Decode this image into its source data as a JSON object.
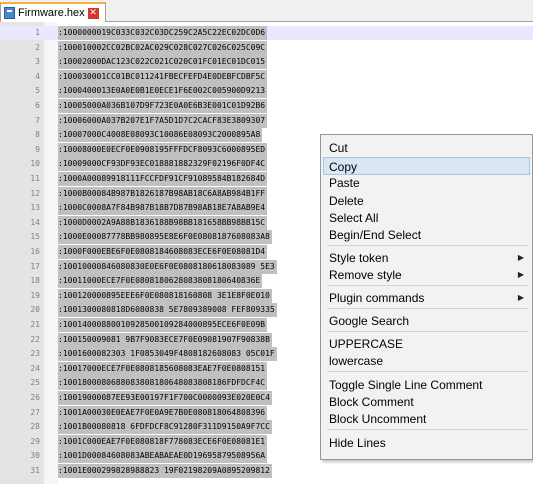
{
  "tab": {
    "title": "Firmware.hex",
    "file_icon": "file-icon",
    "close_icon": "close-icon"
  },
  "editor": {
    "lines": [
      {
        "n": "1",
        "text": ":1000000019C033C032C03DC259C2A5C22EC02DC0D6"
      },
      {
        "n": "2",
        "text": ":100010002CC02BC02AC029C028C027C026C025C09C"
      },
      {
        "n": "3",
        "text": ":10002000DAC123C022C021C020C01FC01EC01DC015"
      },
      {
        "n": "4",
        "text": ":100030001CC01BC011241FBECFEFD4E0DEBFCDBF5C"
      },
      {
        "n": "5",
        "text": ":1000400013E0A0E0B1E0ECE1F6E002C005900D9213"
      },
      {
        "n": "6",
        "text": ":10005000A036B107D9F723E0A0E6B3E001C01D92B6"
      },
      {
        "n": "7",
        "text": ":10006000A037B207E1F7A5D1D7C2CACF83E3809307"
      },
      {
        "n": "8",
        "text": ":10007000C4008E08093C10086E08093C2000895A8"
      },
      {
        "n": "9",
        "text": ":10008000E0ECF0E0908195FFFDCF8093C6000895ED"
      },
      {
        "n": "10",
        "text": ":10009000CF93DF93EC018881882329F02196F0DF4C"
      },
      {
        "n": "11",
        "text": ":1000A00089918111FCCFDF91CF91089584B182684D"
      },
      {
        "n": "12",
        "text": ":1000B00084B987B1826187B98AB18C6A8AB984B1FF"
      },
      {
        "n": "13",
        "text": ":1000C0008A7F84B987B18B7D87B98AB18E7A8AB9E4"
      },
      {
        "n": "14",
        "text": ":1000D0002A9A88B1836188B98BB181658BB98BB15C"
      },
      {
        "n": "15",
        "text": ":1000E00087778BB980895E8E6F0E0808187608083A8"
      },
      {
        "n": "16",
        "text": ":1000F000EBE6F0E0808184608083ECE6F0E08081D4"
      },
      {
        "n": "17",
        "text": ":10010000846080830E0E6F0E0808180618083089 5E3"
      },
      {
        "n": "18",
        "text": ":10011000ECE7F0E0808180628083808180640836E"
      },
      {
        "n": "19",
        "text": ":100120000895EEE6F0E080818160808 3E1E8F0E010"
      },
      {
        "n": "20",
        "text": ":1001300080818D6080838 5E7809389008 FEF809335"
      },
      {
        "n": "21",
        "text": ":10014000880010928500109284000895ECE6F0E09B"
      },
      {
        "n": "22",
        "text": ":100150009081 9B7F9083ECE7F0E09081907F90838B"
      },
      {
        "n": "23",
        "text": ":1001600082303 1F0853049F4808182608083 05C01F"
      },
      {
        "n": "24",
        "text": ":10017000ECE7F0E0808185608083EAE7F0E0808151"
      },
      {
        "n": "25",
        "text": ":1001800080688083808180648083808186FDFDCF4C"
      },
      {
        "n": "26",
        "text": ":10019000087EE93E00197F1F700C0000093E020E0C4"
      },
      {
        "n": "27",
        "text": ":1001A00030E0EAE7F0E0A9E7B0E080818064808396"
      },
      {
        "n": "28",
        "text": ":1001B00080818 6FDFDCF8C91280F311D9150A9F7CC"
      },
      {
        "n": "29",
        "text": ":1001C000EAE7F0E080818F778083ECE6F0E08081E1"
      },
      {
        "n": "30",
        "text": ":1001D00084608083ABEABAEAE0D19695879508956A"
      },
      {
        "n": "31",
        "text": ":1001E000299828988823 19F02198209A0895209812"
      }
    ]
  },
  "context_menu": {
    "items": [
      {
        "label": "Cut",
        "submenu": false
      },
      {
        "label": "Copy",
        "submenu": false,
        "highlighted": true
      },
      {
        "label": "Paste",
        "submenu": false
      },
      {
        "label": "Delete",
        "submenu": false
      },
      {
        "label": "Select All",
        "submenu": false
      },
      {
        "label": "Begin/End Select",
        "submenu": false
      },
      {
        "label": "Style token",
        "submenu": true
      },
      {
        "label": "Remove style",
        "submenu": true
      },
      {
        "label": "Plugin commands",
        "submenu": true
      },
      {
        "label": "Google Search",
        "submenu": false
      },
      {
        "label": "UPPERCASE",
        "submenu": false
      },
      {
        "label": "lowercase",
        "submenu": false
      },
      {
        "label": "Toggle Single Line Comment",
        "submenu": false
      },
      {
        "label": "Block Comment",
        "submenu": false
      },
      {
        "label": "Block Uncomment",
        "submenu": false
      },
      {
        "label": "Hide Lines",
        "submenu": false
      }
    ],
    "submenu_icon": "chevron-right-icon"
  }
}
